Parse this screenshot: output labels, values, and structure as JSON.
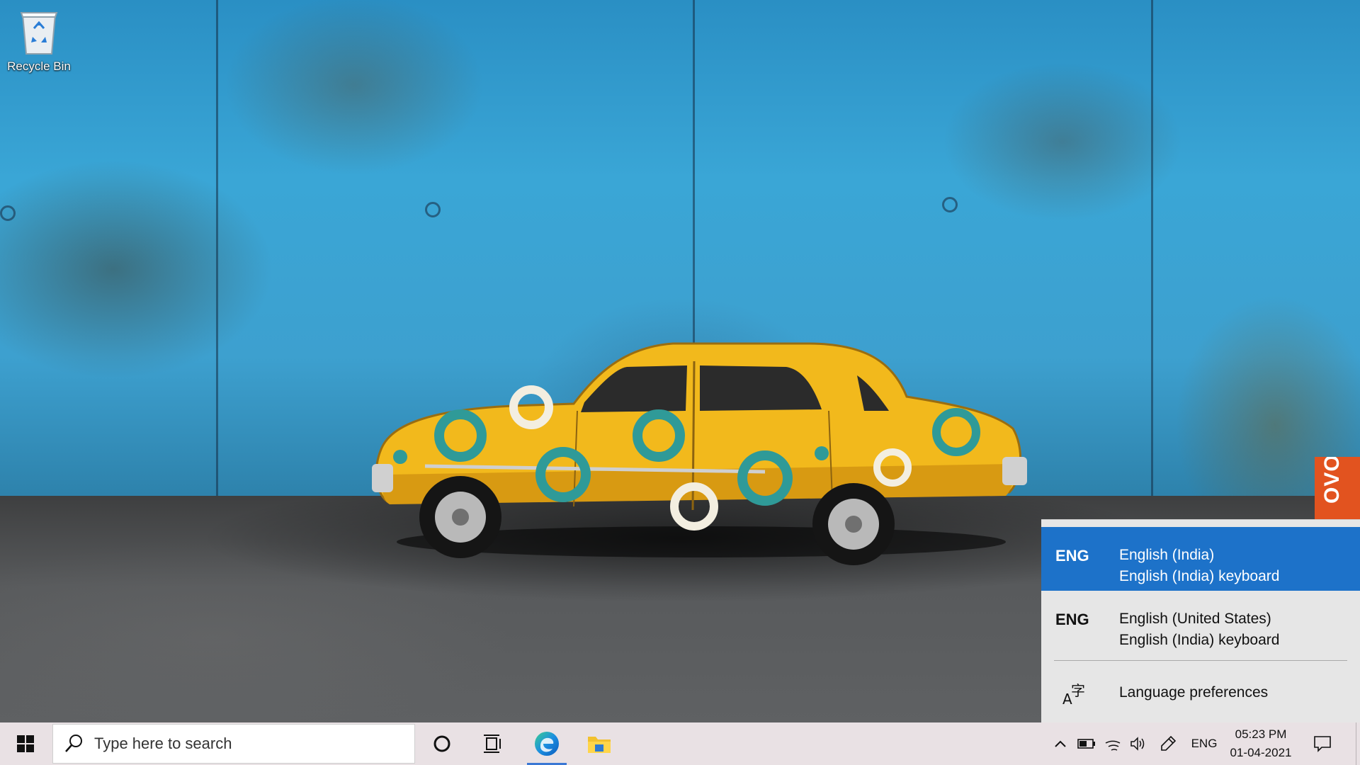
{
  "desktop": {
    "icons": [
      {
        "label": "Recycle Bin",
        "icon": "recycle-bin-icon"
      }
    ],
    "wallpaper": "yellow-car-blue-wall",
    "oem_tab": {
      "text": "OVO",
      "color": "#e2531f"
    }
  },
  "language_flyout": {
    "items": [
      {
        "code": "ENG",
        "language": "English (India)",
        "keyboard": "English (India) keyboard",
        "selected": true
      },
      {
        "code": "ENG",
        "language": "English (United States)",
        "keyboard": "English (India) keyboard",
        "selected": false
      }
    ],
    "preferences_label": "Language preferences",
    "selected_color": "#1d72c9"
  },
  "taskbar": {
    "search": {
      "placeholder": "Type here to search"
    },
    "pinned": [
      {
        "name": "cortana",
        "icon": "circle-icon"
      },
      {
        "name": "task-view",
        "icon": "task-view-icon"
      },
      {
        "name": "edge",
        "icon": "edge-icon",
        "active": true
      },
      {
        "name": "file-explorer",
        "icon": "folder-icon"
      }
    ],
    "tray": {
      "language": "ENG",
      "time": "05:23 PM",
      "date": "01-04-2021"
    },
    "background": "#e9e1e4"
  }
}
